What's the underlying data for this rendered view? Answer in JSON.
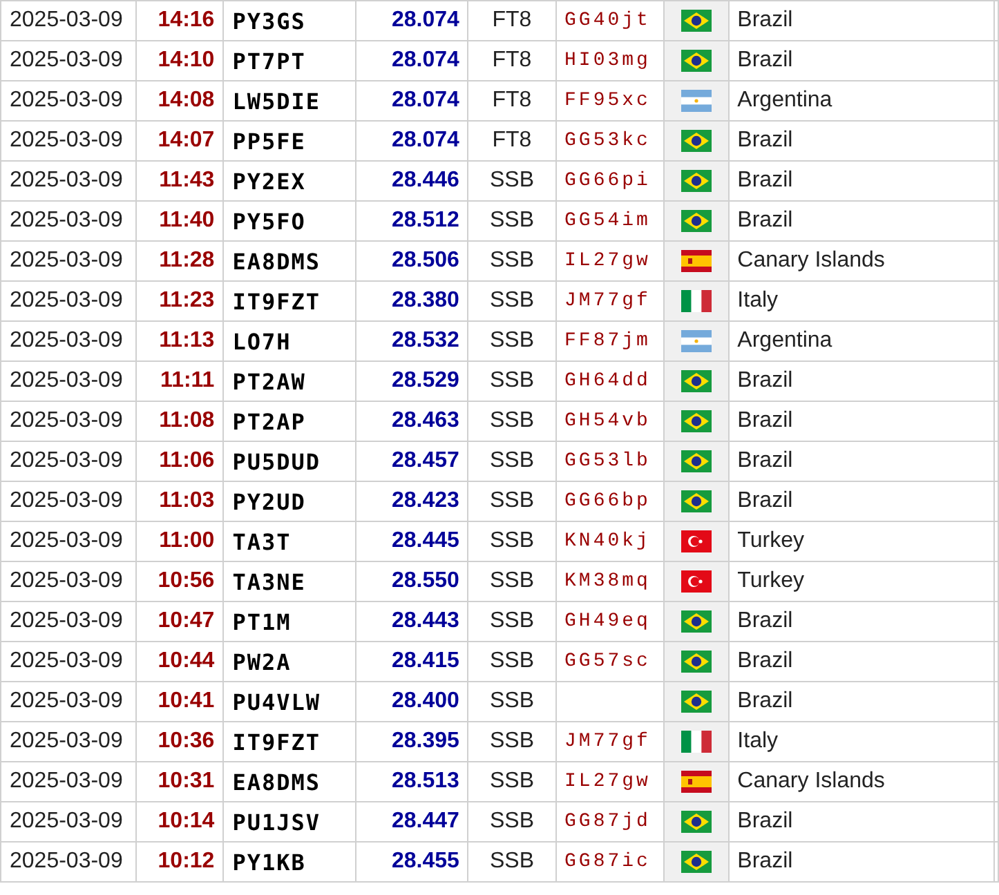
{
  "table": {
    "rows": [
      {
        "date": "2025-03-09",
        "time": "14:16",
        "call": "PY3GS",
        "freq": "28.074",
        "mode": "FT8",
        "grid": "GG40jt",
        "kind": "brazil",
        "country": "Brazil"
      },
      {
        "date": "2025-03-09",
        "time": "14:10",
        "call": "PT7PT",
        "freq": "28.074",
        "mode": "FT8",
        "grid": "HI03mg",
        "kind": "brazil",
        "country": "Brazil"
      },
      {
        "date": "2025-03-09",
        "time": "14:08",
        "call": "LW5DIE",
        "freq": "28.074",
        "mode": "FT8",
        "grid": "FF95xc",
        "kind": "argentina",
        "country": "Argentina"
      },
      {
        "date": "2025-03-09",
        "time": "14:07",
        "call": "PP5FE",
        "freq": "28.074",
        "mode": "FT8",
        "grid": "GG53kc",
        "kind": "brazil",
        "country": "Brazil"
      },
      {
        "date": "2025-03-09",
        "time": "11:43",
        "call": "PY2EX",
        "freq": "28.446",
        "mode": "SSB",
        "grid": "GG66pi",
        "kind": "brazil",
        "country": "Brazil"
      },
      {
        "date": "2025-03-09",
        "time": "11:40",
        "call": "PY5FO",
        "freq": "28.512",
        "mode": "SSB",
        "grid": "GG54im",
        "kind": "brazil",
        "country": "Brazil"
      },
      {
        "date": "2025-03-09",
        "time": "11:28",
        "call": "EA8DMS",
        "freq": "28.506",
        "mode": "SSB",
        "grid": "IL27gw",
        "kind": "spain",
        "country": "Canary Islands"
      },
      {
        "date": "2025-03-09",
        "time": "11:23",
        "call": "IT9FZT",
        "freq": "28.380",
        "mode": "SSB",
        "grid": "JM77gf",
        "kind": "italy",
        "country": "Italy"
      },
      {
        "date": "2025-03-09",
        "time": "11:13",
        "call": "LO7H",
        "freq": "28.532",
        "mode": "SSB",
        "grid": "FF87jm",
        "kind": "argentina",
        "country": "Argentina"
      },
      {
        "date": "2025-03-09",
        "time": "11:11",
        "call": "PT2AW",
        "freq": "28.529",
        "mode": "SSB",
        "grid": "GH64dd",
        "kind": "brazil",
        "country": "Brazil"
      },
      {
        "date": "2025-03-09",
        "time": "11:08",
        "call": "PT2AP",
        "freq": "28.463",
        "mode": "SSB",
        "grid": "GH54vb",
        "kind": "brazil",
        "country": "Brazil"
      },
      {
        "date": "2025-03-09",
        "time": "11:06",
        "call": "PU5DUD",
        "freq": "28.457",
        "mode": "SSB",
        "grid": "GG53lb",
        "kind": "brazil",
        "country": "Brazil"
      },
      {
        "date": "2025-03-09",
        "time": "11:03",
        "call": "PY2UD",
        "freq": "28.423",
        "mode": "SSB",
        "grid": "GG66bp",
        "kind": "brazil",
        "country": "Brazil"
      },
      {
        "date": "2025-03-09",
        "time": "11:00",
        "call": "TA3T",
        "freq": "28.445",
        "mode": "SSB",
        "grid": "KN40kj",
        "kind": "turkey",
        "country": "Turkey"
      },
      {
        "date": "2025-03-09",
        "time": "10:56",
        "call": "TA3NE",
        "freq": "28.550",
        "mode": "SSB",
        "grid": "KM38mq",
        "kind": "turkey",
        "country": "Turkey"
      },
      {
        "date": "2025-03-09",
        "time": "10:47",
        "call": "PT1M",
        "freq": "28.443",
        "mode": "SSB",
        "grid": "GH49eq",
        "kind": "brazil",
        "country": "Brazil"
      },
      {
        "date": "2025-03-09",
        "time": "10:44",
        "call": "PW2A",
        "freq": "28.415",
        "mode": "SSB",
        "grid": "GG57sc",
        "kind": "brazil",
        "country": "Brazil"
      },
      {
        "date": "2025-03-09",
        "time": "10:41",
        "call": "PU4VLW",
        "freq": "28.400",
        "mode": "SSB",
        "kind": "brazil",
        "country": "Brazil"
      },
      {
        "date": "2025-03-09",
        "time": "10:36",
        "call": "IT9FZT",
        "freq": "28.395",
        "mode": "SSB",
        "grid": "JM77gf",
        "kind": "italy",
        "country": "Italy"
      },
      {
        "date": "2025-03-09",
        "time": "10:31",
        "call": "EA8DMS",
        "freq": "28.513",
        "mode": "SSB",
        "grid": "IL27gw",
        "kind": "spain",
        "country": "Canary Islands"
      },
      {
        "date": "2025-03-09",
        "time": "10:14",
        "call": "PU1JSV",
        "freq": "28.447",
        "mode": "SSB",
        "grid": "GG87jd",
        "kind": "brazil",
        "country": "Brazil"
      },
      {
        "date": "2025-03-09",
        "time": "10:12",
        "call": "PY1KB",
        "freq": "28.455",
        "mode": "SSB",
        "grid": "GG87ic",
        "kind": "brazil",
        "country": "Brazil"
      }
    ]
  }
}
